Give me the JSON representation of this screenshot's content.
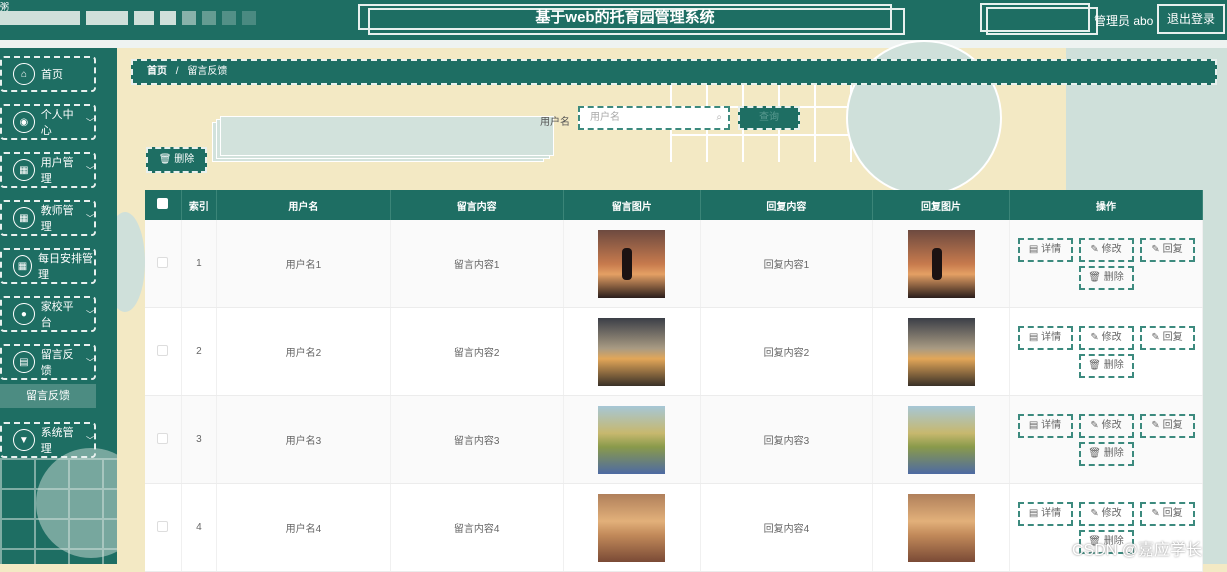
{
  "corner_text": "粥",
  "header": {
    "title": "基于web的托育园管理系统",
    "user_label": "管理员 abo",
    "logout": "退出登录"
  },
  "sidebar": {
    "items": [
      {
        "label": "首页",
        "icon": "home-icon",
        "glyph": "⌂",
        "chevron": false
      },
      {
        "label": "个人中心",
        "icon": "person-icon",
        "glyph": "◉",
        "chevron": true
      },
      {
        "label": "用户管理",
        "icon": "grid-icon",
        "glyph": "▦",
        "chevron": true
      },
      {
        "label": "教师管理",
        "icon": "grid-icon",
        "glyph": "▦",
        "chevron": true
      },
      {
        "label": "每日安排管理",
        "icon": "grid-icon",
        "glyph": "▦",
        "chevron": false
      },
      {
        "label": "家校平台",
        "icon": "bulb-icon",
        "glyph": "●",
        "chevron": true
      },
      {
        "label": "留言反馈",
        "icon": "chat-icon",
        "glyph": "▤",
        "chevron": true
      },
      {
        "label": "系统管理",
        "icon": "trophy-icon",
        "glyph": "▼",
        "chevron": true
      }
    ],
    "sub_item": "留言反馈"
  },
  "breadcrumb": {
    "home": "首页",
    "sep": "/",
    "current": "留言反馈"
  },
  "search": {
    "label": "用户名",
    "placeholder": "用户名",
    "button": "查询"
  },
  "toolbar": {
    "delete": "删除"
  },
  "table": {
    "headers": [
      "",
      "索引",
      "用户名",
      "留言内容",
      "留言图片",
      "回复内容",
      "回复图片",
      "操作"
    ],
    "rows": [
      {
        "index": "1",
        "username": "用户名1",
        "content": "留言内容1",
        "reply": "回复内容1"
      },
      {
        "index": "2",
        "username": "用户名2",
        "content": "留言内容2",
        "reply": "回复内容2"
      },
      {
        "index": "3",
        "username": "用户名3",
        "content": "留言内容3",
        "reply": "回复内容3"
      },
      {
        "index": "4",
        "username": "用户名4",
        "content": "留言内容4",
        "reply": "回复内容4"
      }
    ],
    "actions": {
      "detail": "详情",
      "edit": "修改",
      "reply": "回复",
      "delete": "删除"
    }
  },
  "watermark": "CSDN @嘉应学长",
  "colors": {
    "primary": "#1e6e63",
    "accent_light": "#cfe0da",
    "background": "#f3e9c4"
  }
}
